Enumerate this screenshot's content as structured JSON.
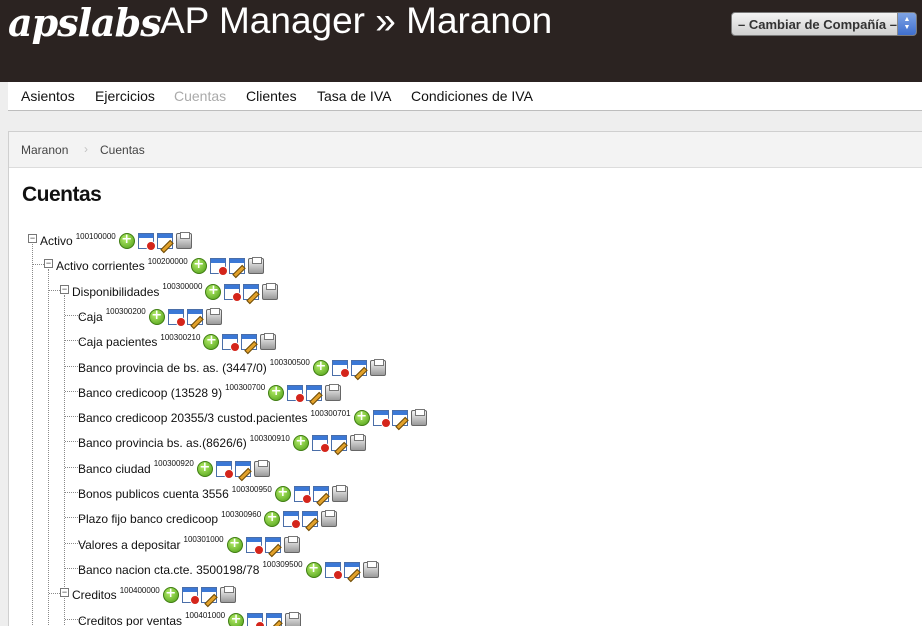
{
  "header": {
    "logo": "apslabs",
    "title": "AP Manager » Maranon",
    "company_select": "– Cambiar de Compañía –"
  },
  "nav": [
    {
      "label": "Asientos"
    },
    {
      "label": "Ejercicios"
    },
    {
      "label": "Cuentas"
    },
    {
      "label": "Clientes"
    },
    {
      "label": "Tasa de IVA"
    },
    {
      "label": "Condiciones de IVA"
    }
  ],
  "breadcrumb": [
    "Maranon",
    "Cuentas"
  ],
  "page_title": "Cuentas",
  "tree": [
    {
      "name": "Activo",
      "code": "100100000",
      "level": 0
    },
    {
      "name": "Activo corrientes",
      "code": "100200000",
      "level": 1
    },
    {
      "name": "Disponibilidades",
      "code": "100300000",
      "level": 2
    },
    {
      "name": "Caja",
      "code": "100300200",
      "level": 3
    },
    {
      "name": "Caja pacientes",
      "code": "100300210",
      "level": 3
    },
    {
      "name": "Banco provincia de bs. as. (3447/0)",
      "code": "100300500",
      "level": 3
    },
    {
      "name": "Banco credicoop (13528 9)",
      "code": "100300700",
      "level": 3
    },
    {
      "name": "Banco credicoop 20355/3 custod.pacientes",
      "code": "100300701",
      "level": 3
    },
    {
      "name": "Banco provincia bs. as.(8626/6)",
      "code": "100300910",
      "level": 3
    },
    {
      "name": "Banco ciudad",
      "code": "100300920",
      "level": 3
    },
    {
      "name": "Bonos publicos cuenta 3556",
      "code": "100300950",
      "level": 3
    },
    {
      "name": "Plazo fijo banco credicoop",
      "code": "100300960",
      "level": 3
    },
    {
      "name": "Valores a depositar",
      "code": "100301000",
      "level": 3
    },
    {
      "name": "Banco nacion cta.cte. 3500198/78",
      "code": "100309500",
      "level": 3
    },
    {
      "name": "Creditos",
      "code": "100400000",
      "level": 2
    },
    {
      "name": "Creditos por ventas",
      "code": "100401000",
      "level": 3
    }
  ]
}
